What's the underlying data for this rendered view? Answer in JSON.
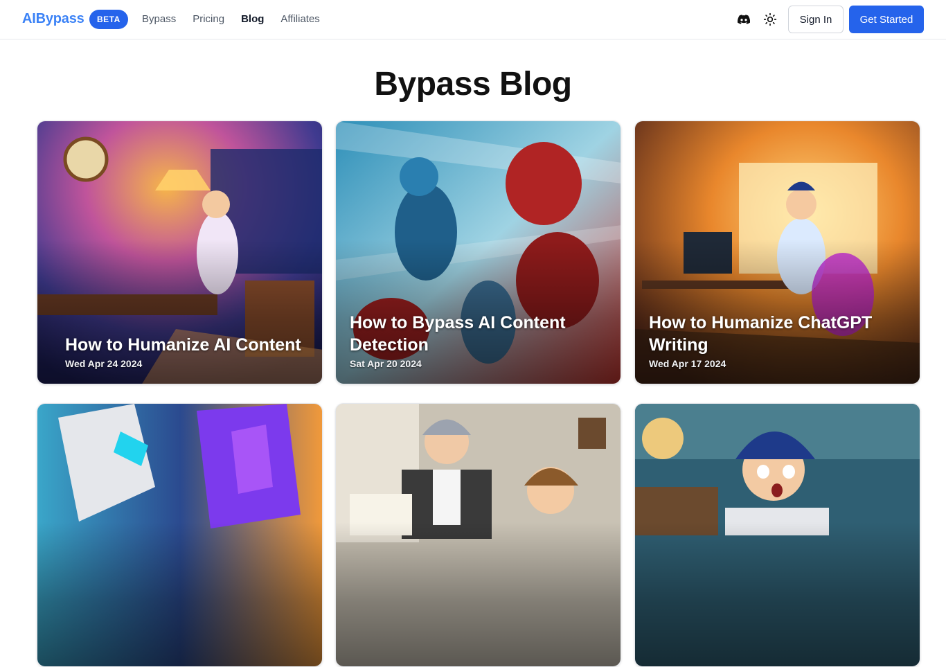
{
  "header": {
    "logo": "AIBypass",
    "badge": "BETA",
    "nav": [
      {
        "label": "Bypass"
      },
      {
        "label": "Pricing"
      },
      {
        "label": "Blog",
        "active": true
      },
      {
        "label": "Affiliates"
      }
    ],
    "icons": [
      "discord-icon",
      "sun-icon"
    ],
    "sign_in": "Sign In",
    "get_started": "Get Started"
  },
  "page": {
    "title": "Bypass Blog"
  },
  "posts": [
    {
      "title": "How to Humanize AI Content",
      "date": "Wed Apr 24 2024"
    },
    {
      "title": "How to Bypass AI Content Detection",
      "date": "Sat Apr 20 2024"
    },
    {
      "title": "How to Humanize ChatGPT Writing",
      "date": "Wed Apr 17 2024"
    },
    {
      "title": "",
      "date": ""
    },
    {
      "title": "",
      "date": ""
    },
    {
      "title": "",
      "date": ""
    }
  ],
  "colors": {
    "brand": "#3b82f6",
    "primary_button": "#2563eb",
    "border": "#e5e7eb"
  }
}
